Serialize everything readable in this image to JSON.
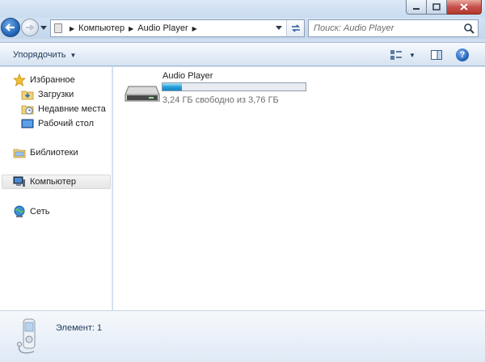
{
  "window": {
    "caption_buttons": [
      "minimize",
      "maximize",
      "close"
    ]
  },
  "address_bar": {
    "breadcrumbs": [
      "Компьютер",
      "Audio Player"
    ],
    "separator_glyph": "▶"
  },
  "search": {
    "placeholder": "Поиск: Audio Player"
  },
  "toolbar": {
    "organize_label": "Упорядочить",
    "dropdown_glyph": "▼",
    "help_glyph": "?"
  },
  "nav_pane": {
    "favorites": {
      "label": "Избранное",
      "icon": "star-icon",
      "items": [
        {
          "label": "Загрузки",
          "icon": "downloads-folder-icon"
        },
        {
          "label": "Недавние места",
          "icon": "recent-places-icon"
        },
        {
          "label": "Рабочий стол",
          "icon": "desktop-icon"
        }
      ]
    },
    "libraries": {
      "label": "Библиотеки",
      "icon": "libraries-icon"
    },
    "computer": {
      "label": "Компьютер",
      "icon": "computer-icon",
      "selected": true
    },
    "network": {
      "label": "Сеть",
      "icon": "network-icon"
    }
  },
  "content": {
    "drive": {
      "name": "Audio Player",
      "free_text": "3,24 ГБ свободно из 3,76 ГБ",
      "used_fraction": 0.138,
      "icon": "removable-drive-icon",
      "bar_color": "#26a0da"
    }
  },
  "details_pane": {
    "item_count": "Элемент: 1",
    "icon": "mp3-player-icon"
  }
}
